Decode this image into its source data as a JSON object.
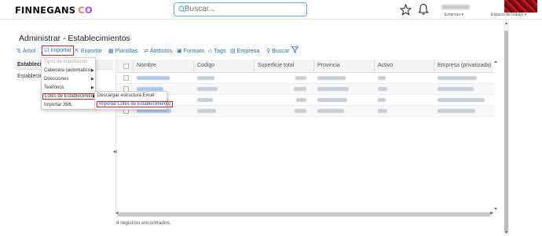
{
  "brand": {
    "name": "FINNEGANS",
    "suffix": "CO"
  },
  "search": {
    "placeholder": "Buscar..."
  },
  "header": {
    "empresa_label": "Empresa ▾",
    "espacio_label": "Espacio de trabajo ▾"
  },
  "page": {
    "title": "Administrar - Establecimientos"
  },
  "toolbar": {
    "arbol": "Árbol",
    "importar": "Importar",
    "exportar": "Exportar",
    "plantillas": "Plantillas",
    "atributos": "Atributos",
    "formato": "Formato",
    "tags": "Tags",
    "empresa": "Empresa",
    "buscar": "Buscar"
  },
  "left_panel": {
    "header": "Establecimi",
    "item": "Establecimi"
  },
  "grid": {
    "columns": [
      "Nombre",
      "Codigo",
      "Superficie total",
      "Provincia",
      "Activo",
      "Empresa (privatizada)"
    ],
    "rows": 4
  },
  "status": {
    "records": "4 registros encontrados."
  },
  "import_menu": {
    "items": [
      {
        "label": "Tipos de importacion",
        "disabled": true,
        "submenu": false
      },
      {
        "label": "Cabecera (automatico)",
        "disabled": false,
        "submenu": true
      },
      {
        "label": "Direcciones",
        "disabled": false,
        "submenu": true
      },
      {
        "label": "Telefonos",
        "disabled": false,
        "submenu": true
      },
      {
        "label": "Lotes de Establecimiento",
        "disabled": false,
        "submenu": true
      },
      {
        "label": "Importar XML",
        "disabled": false,
        "submenu": false
      }
    ]
  },
  "submenu": {
    "items": [
      "Descargar estructura Excel",
      "Importar Lotes de Establecimiento"
    ]
  },
  "colors": {
    "accent": "#2a73b8",
    "highlight_border": "#d9252c",
    "search_border": "#4fb3e0"
  }
}
